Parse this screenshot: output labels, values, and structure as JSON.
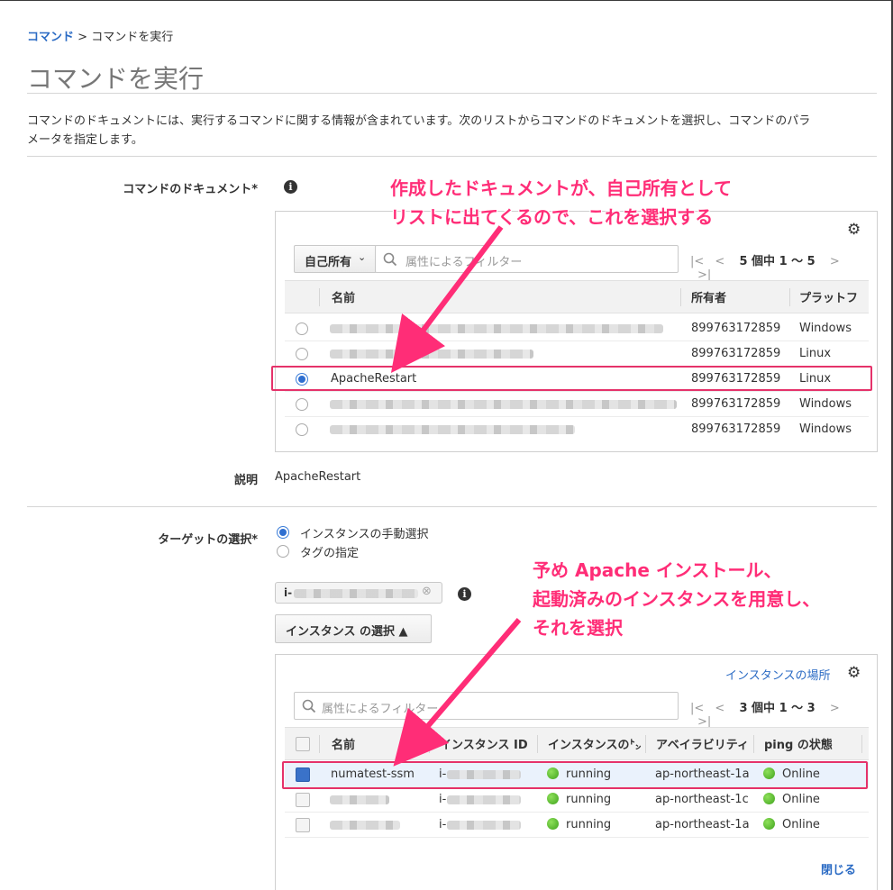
{
  "breadcrumb": {
    "link": "コマンド",
    "sep": ">",
    "current": "コマンドを実行"
  },
  "page_title": "コマンドを実行",
  "description_line1": "コマンドのドキュメントには、実行するコマンドに関する情報が含まれています。次のリストからコマンドのドキュメントを選択し、コマンドのパラ",
  "description_line2": "メータを指定します。",
  "document_section": {
    "label": "コマンドのドキュメント*",
    "owner_filter": "自己所有",
    "search_placeholder": "属性によるフィルター",
    "pager_text": "5 個中 1 〜 5",
    "columns": [
      "名前",
      "所有者",
      "プラットフ"
    ],
    "rows": [
      {
        "name": "",
        "owner": "899763172859",
        "platform": "Windows",
        "selected": false
      },
      {
        "name": "",
        "owner": "899763172859",
        "platform": "Linux",
        "selected": false
      },
      {
        "name": "ApacheRestart",
        "owner": "899763172859",
        "platform": "Linux",
        "selected": true
      },
      {
        "name": "",
        "owner": "899763172859",
        "platform": "Windows",
        "selected": false
      },
      {
        "name": "",
        "owner": "899763172859",
        "platform": "Windows",
        "selected": false
      }
    ]
  },
  "explanation": {
    "label": "説明",
    "value": "ApacheRestart"
  },
  "target_section": {
    "label": "ターゲットの選択*",
    "option_manual": "インスタンスの手動選択",
    "option_tag": "タグの指定",
    "chip_text": "i-",
    "select_button": "インスタンス の選択 ▲",
    "location_link": "インスタンスの場所",
    "search_placeholder": "属性によるフィルター",
    "pager_text": "3 個中 1 〜 3",
    "columns": [
      "名前",
      "インスタンス ID",
      "インスタンスの㌧",
      "アベイラビリティ",
      "ping の状態"
    ],
    "rows": [
      {
        "name": "numatest-ssm",
        "id": "i-",
        "state": "running",
        "az": "ap-northeast-1a",
        "ping": "Online",
        "selected": true
      },
      {
        "name": "",
        "id": "i-",
        "state": "running",
        "az": "ap-northeast-1c",
        "ping": "Online",
        "selected": false
      },
      {
        "name": "",
        "id": "i-",
        "state": "running",
        "az": "ap-northeast-1a",
        "ping": "Online",
        "selected": false
      }
    ],
    "close_link": "閉じる"
  },
  "annotations": {
    "note1_line1": "作成したドキュメントが、自己所有として",
    "note1_line2": "リストに出てくるので、これを選択する",
    "note2_line1": "予め Apache インストール、",
    "note2_line2": "起動済みのインスタンスを用意し、",
    "note2_line3": "それを選択"
  },
  "colors": {
    "accent": "#2b6bc4",
    "annotation": "#ff2d77",
    "highlight_box": "#e5326a"
  }
}
